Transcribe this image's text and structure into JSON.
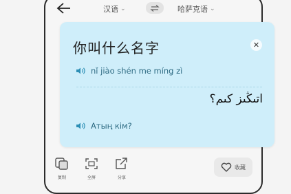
{
  "topbar": {
    "source_language": "汉语",
    "target_language": "哈萨克语"
  },
  "card": {
    "source_text": "你叫什么名字",
    "pinyin": "nǐ jiào shén me míng zì",
    "translation": "اتىڭىز كىم؟",
    "transliteration": "Атың кім?",
    "close_icon": "close-icon",
    "speaker_icon": "speaker-icon"
  },
  "actions": {
    "copy_label": "复制",
    "fullscreen_label": "全屏",
    "share_label": "分享",
    "favorite_label": "收藏"
  },
  "colors": {
    "card_background": "#cfeefa",
    "accent": "#2d8fb5",
    "page_background": "#f4f4f4"
  }
}
